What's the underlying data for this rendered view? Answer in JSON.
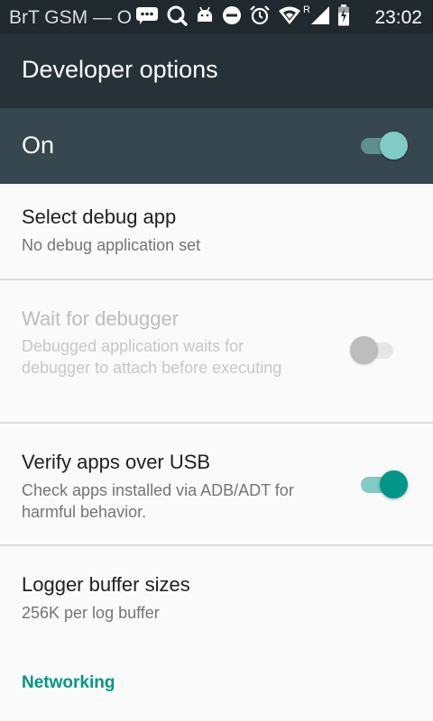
{
  "status_bar": {
    "carrier": "BrT GSM — O",
    "roaming_indicator": "R",
    "time": "23:02",
    "icons": [
      "message-icon",
      "search-icon",
      "android-icon",
      "do-not-disturb-icon",
      "alarm-icon",
      "wifi-icon",
      "signal-icon",
      "battery-icon"
    ]
  },
  "toolbar": {
    "title": "Developer options"
  },
  "master_switch": {
    "label": "On",
    "checked": true
  },
  "settings": [
    {
      "title": "Select debug app",
      "summary": "No debug application set"
    },
    {
      "title": "Wait for debugger",
      "summary": "Debugged application waits for debugger to attach before executing",
      "enabled": false,
      "checked": false
    },
    {
      "title": "Verify apps over USB",
      "summary": "Check apps installed via ADB/ADT for harmful behavior.",
      "enabled": true,
      "checked": true
    },
    {
      "title": "Logger buffer sizes",
      "summary": "256K per log buffer"
    }
  ],
  "category": {
    "label": "Networking"
  },
  "colors": {
    "accent": "#009688",
    "accent_light": "#80cbc4",
    "toolbar": "#263238",
    "master_bar": "#37474f"
  }
}
